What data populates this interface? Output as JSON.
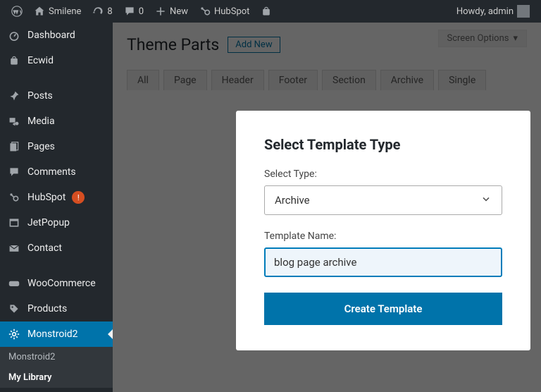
{
  "toolbar": {
    "site": "Smilene",
    "updates": "8",
    "comments": "0",
    "new": "New",
    "hubspot": "HubSpot",
    "howdy": "Howdy, admin"
  },
  "sidebar": {
    "items": [
      {
        "label": "Dashboard",
        "icon": "dashboard"
      },
      {
        "label": "Ecwid",
        "icon": "cart"
      },
      {
        "label": "Posts",
        "icon": "pin"
      },
      {
        "label": "Media",
        "icon": "media"
      },
      {
        "label": "Pages",
        "icon": "page"
      },
      {
        "label": "Comments",
        "icon": "comment"
      },
      {
        "label": "HubSpot",
        "icon": "hubspot",
        "badge": "!"
      },
      {
        "label": "JetPopup",
        "icon": "popup"
      },
      {
        "label": "Contact",
        "icon": "mail"
      },
      {
        "label": "WooCommerce",
        "icon": "woo"
      },
      {
        "label": "Products",
        "icon": "product"
      },
      {
        "label": "Monstroid2",
        "icon": "gear",
        "active": true
      }
    ],
    "sub": [
      {
        "label": "Monstroid2"
      },
      {
        "label": "My Library",
        "current": true
      }
    ]
  },
  "content": {
    "screen_options": "Screen Options",
    "title": "Theme Parts",
    "add_new": "Add New",
    "tabs": [
      "All",
      "Page",
      "Header",
      "Footer",
      "Section",
      "Archive",
      "Single"
    ]
  },
  "modal": {
    "title": "Select Template Type",
    "type_label": "Select Type:",
    "type_value": "Archive",
    "name_label": "Template Name:",
    "name_value": "blog page archive",
    "button": "Create Template"
  }
}
